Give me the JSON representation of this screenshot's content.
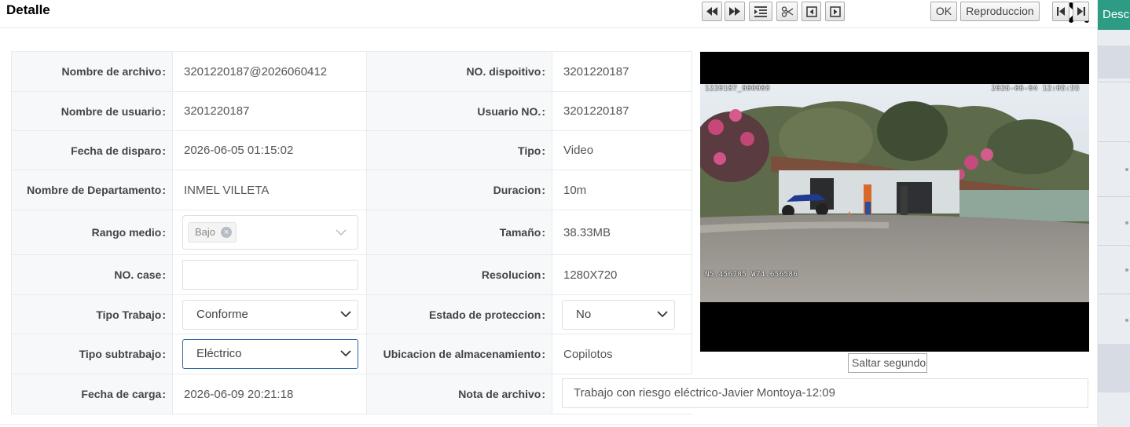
{
  "modal": {
    "title": "Detalle"
  },
  "background": {
    "button_label": "Desc"
  },
  "fields": {
    "file_name": {
      "label": "Nombre de archivo",
      "value": "3201220187@2026060412"
    },
    "device_no": {
      "label": "NO. dispoitivo",
      "value": "3201220187"
    },
    "user_name": {
      "label": "Nombre de usuario",
      "value": "3201220187"
    },
    "user_no": {
      "label": "Usuario NO.",
      "value": "3201220187"
    },
    "trigger_date": {
      "label": "Fecha de disparo",
      "value": "2026-06-05 01:15:02"
    },
    "type": {
      "label": "Tipo",
      "value": "Video"
    },
    "department": {
      "label": "Nombre de Departamento",
      "value": "INMEL VILLETA"
    },
    "duration": {
      "label": "Duracion",
      "value": "10m"
    },
    "medium_range": {
      "label": "Rango medio",
      "tag": "Bajo"
    },
    "size": {
      "label": "Tamaño",
      "value": "38.33MB"
    },
    "case_no": {
      "label": "NO. case",
      "value": ""
    },
    "resolution": {
      "label": "Resolucion",
      "value": "1280X720"
    },
    "work_type": {
      "label": "Tipo Trabajo",
      "value": "Conforme"
    },
    "protection_state": {
      "label": "Estado de proteccion",
      "value": "No"
    },
    "work_subtype": {
      "label": "Tipo subtrabajo",
      "value": "Eléctrico"
    },
    "storage_location": {
      "label": "Ubicacion de almacenamiento",
      "value": "Copilotos"
    },
    "upload_date": {
      "label": "Fecha de carga",
      "value": "2026-06-09 20:21:18"
    },
    "file_note": {
      "label": "Nota de archivo",
      "value": "Trabajo con riesgo eléctrico-Javier Montoya-12:09"
    }
  },
  "video": {
    "osd_top_left": "1220187_000000",
    "osd_top_right": "2026-06-04 12:05:55",
    "osd_bottom_left": "N5.456785 W74.656586"
  },
  "player_controls": {
    "seek_placeholder": "Saltar segundos",
    "ok_label": "OK",
    "playback_label": "Reproduccion"
  },
  "colors": {
    "accent": "#2e9b84",
    "active_border": "#2d66a3"
  }
}
